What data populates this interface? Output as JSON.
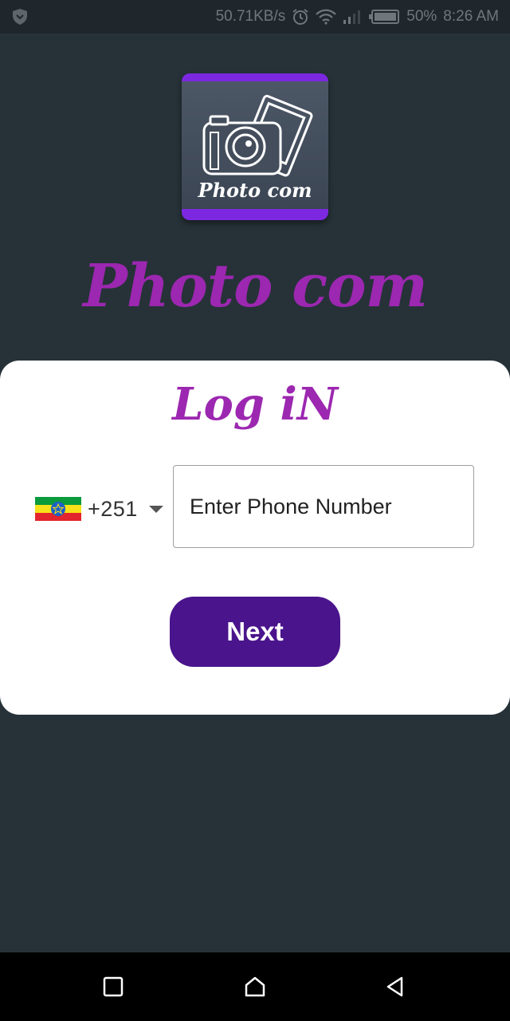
{
  "status_bar": {
    "network_speed": "50.71KB/s",
    "battery_percent": "50%",
    "time": "8:26 AM",
    "icons": [
      "shield-icon",
      "alarm-icon",
      "wifi-icon",
      "signal-icon",
      "battery-icon"
    ]
  },
  "logo": {
    "label": "Photo com",
    "icon": "camera-photo-icon",
    "accent_color": "#7c28e0"
  },
  "brand": {
    "title": "Photo com",
    "color": "#9c27b0"
  },
  "login_card": {
    "title": "Log iN",
    "country": {
      "flag": "ethiopia-flag-icon",
      "dial_code": "+251"
    },
    "phone_input": {
      "placeholder": "Enter Phone Number",
      "value": ""
    },
    "next_label": "Next",
    "button_color": "#4a148c"
  },
  "nav_bar": {
    "icons": [
      "recents-icon",
      "home-icon",
      "back-icon"
    ]
  }
}
